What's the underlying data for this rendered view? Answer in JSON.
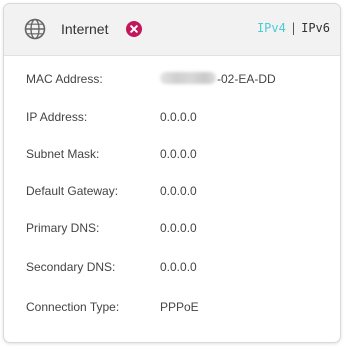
{
  "header": {
    "title": "Internet",
    "status_icon": "close-icon",
    "status_color": "#c2185b",
    "ipv4_label": "IPv4",
    "separator": "|",
    "ipv6_label": "IPv6",
    "active_tab_color": "#4acbd6"
  },
  "details": {
    "mac_label": "MAC Address:",
    "mac_value_visible": "-02-EA-DD",
    "ip_label": "IP Address:",
    "ip_value": "0.0.0.0",
    "subnet_label": "Subnet Mask:",
    "subnet_value": "0.0.0.0",
    "gateway_label": "Default Gateway:",
    "gateway_value": "0.0.0.0",
    "primary_dns_label": "Primary DNS:",
    "primary_dns_value": "0.0.0.0",
    "secondary_dns_label": "Secondary DNS:",
    "secondary_dns_value": "0.0.0.0",
    "connection_type_label": "Connection Type:",
    "connection_type_value": "PPPoE"
  }
}
